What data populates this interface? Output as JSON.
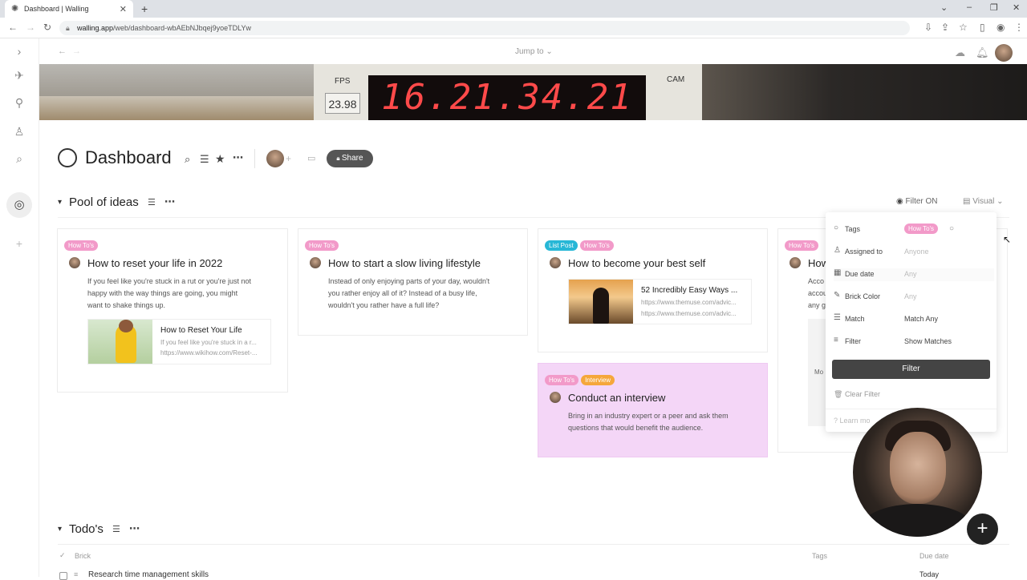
{
  "browser": {
    "tab_title": "Dashboard | Walling",
    "url_host": "walling.app",
    "url_path": "/web/dashboard-wbAEbNJbqej9yoeTDLYw"
  },
  "topbar": {
    "jump_to": "Jump to ⌄"
  },
  "banner": {
    "fps_label": "FPS",
    "fps_value": "23.98",
    "timecode": "16.21.34.21",
    "cam_label": "CAM"
  },
  "dashboard": {
    "title": "Dashboard",
    "share_label": "Share"
  },
  "pool": {
    "title": "Pool of ideas",
    "filter_status": "Filter ON",
    "view_label": "Visual",
    "cards": [
      {
        "tags": [
          "How To's"
        ],
        "title": "How to reset your life in 2022",
        "desc": [
          "If you feel like you're stuck in a rut or you're just not",
          "happy with the way things are going, you might",
          "want to shake things up."
        ],
        "link": {
          "title": "How to Reset Your Life",
          "desc": "If you feel like you're stuck in a r...",
          "url": "https://www.wikihow.com/Reset-..."
        }
      },
      {
        "tags": [
          "How To's"
        ],
        "title": "How to start a slow living lifestyle",
        "desc": [
          "Instead of only enjoying parts of your day, wouldn't",
          "you rather enjoy all of it? Instead of a busy life,",
          "wouldn't you rather have a full life?"
        ]
      },
      {
        "tags": [
          "List Post",
          "How To's"
        ],
        "title": "How to become your best self",
        "link": {
          "title": "52 Incredibly Easy Ways ...",
          "desc": "https://www.themuse.com/advic...",
          "url": "https://www.themuse.com/advic..."
        }
      },
      {
        "tags": [
          "How To's",
          "Interview"
        ],
        "title": "Conduct an interview",
        "desc": [
          "Bring in an industry expert or a peer and ask them",
          "questions that would benefit the audience."
        ]
      },
      {
        "tags": [
          "How To's"
        ],
        "title": "How",
        "desc": [
          "Acco",
          "accou",
          "any g"
        ],
        "partial": "Mo"
      }
    ]
  },
  "filter_panel": {
    "rows": [
      {
        "label": "Tags",
        "value": "How To's"
      },
      {
        "label": "Assigned to",
        "value": "Anyone"
      },
      {
        "label": "Due date",
        "value": "Any"
      },
      {
        "label": "Brick Color",
        "value": "Any"
      },
      {
        "label": "Match",
        "value": "Match Any"
      },
      {
        "label": "Filter",
        "value": "Show Matches"
      }
    ],
    "button": "Filter",
    "clear": "Clear Filter",
    "learn": "Learn mo"
  },
  "todos": {
    "title": "Todo's",
    "col_brick": "Brick",
    "col_tags": "Tags",
    "col_due": "Due date",
    "row1": "Research time management skills",
    "row1_due": "Today"
  },
  "colors": {
    "tag_pink": "#f29ac9",
    "tag_blue": "#27b7d6",
    "tag_orange": "#f5a73b",
    "card_highlight": "#f4d6f7"
  }
}
